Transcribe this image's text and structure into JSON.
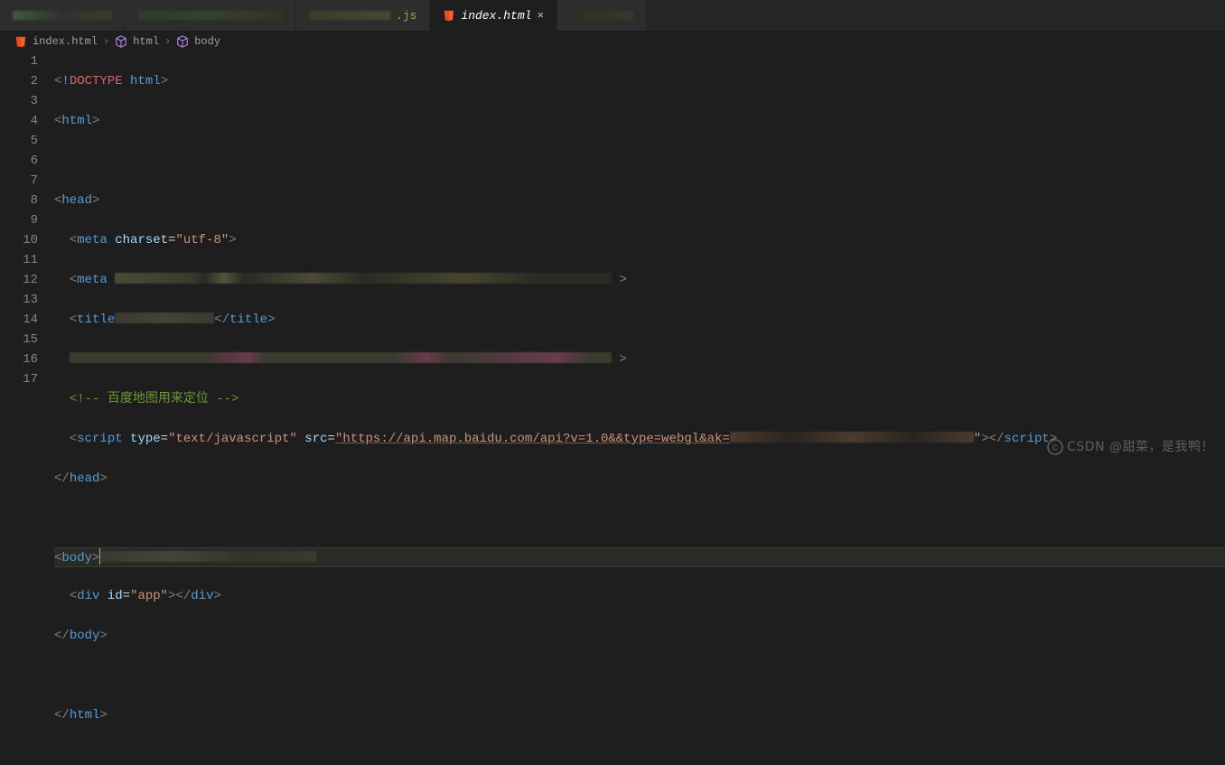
{
  "tabs": [
    {
      "label": "",
      "obscured": true,
      "active": false,
      "closeable": false
    },
    {
      "label": "",
      "obscured": true,
      "active": false,
      "closeable": false
    },
    {
      "label": ".js",
      "prefix_obscured": true,
      "active": false,
      "closeable": false
    },
    {
      "label": "index.html",
      "active": true,
      "closeable": true
    },
    {
      "label": "",
      "obscured": true,
      "active": false,
      "closeable": false
    }
  ],
  "breadcrumb": {
    "file": "index.html",
    "path1": "html",
    "path2": "body"
  },
  "code": {
    "line_count": 17,
    "doctype_open": "<!",
    "doctype_word": "DOCTYPE",
    "doctype_html": "html",
    "meta_attr": "charset",
    "meta_val": "\"utf-8\"",
    "comment": "<!-- 百度地图用来定位 -->",
    "script_tag": "script",
    "type_attr": "type",
    "type_val": "\"text/javascript\"",
    "src_attr": "src",
    "src_val": "\"https://api.map.baidu.com/api?v=1.0&&type=webgl&ak=",
    "div_id_attr": "id",
    "div_id_val": "\"app\"",
    "tags": {
      "html": "html",
      "head": "head",
      "meta": "meta",
      "title": "title",
      "body": "body",
      "div": "div"
    }
  },
  "watermark": "CSDN @甜菜，是我鸭！"
}
